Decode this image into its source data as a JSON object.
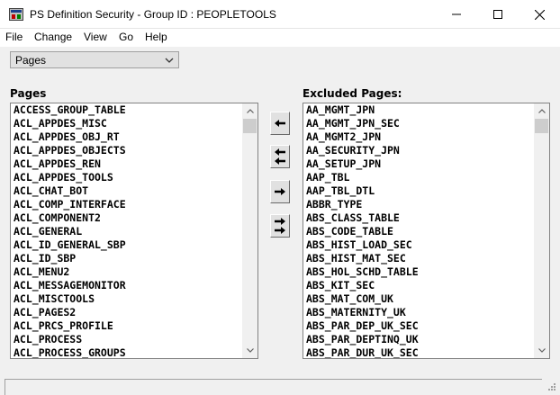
{
  "window": {
    "title": "PS Definition Security - Group ID : PEOPLETOOLS"
  },
  "menu": {
    "items": [
      "File",
      "Change",
      "View",
      "Go",
      "Help"
    ]
  },
  "object_type_select": {
    "value": "Pages"
  },
  "pages_list": {
    "label": "Pages",
    "items": [
      "ACCESS_GROUP_TABLE",
      "ACL_APPDES_MISC",
      "ACL_APPDES_OBJ_RT",
      "ACL_APPDES_OBJECTS",
      "ACL_APPDES_REN",
      "ACL_APPDES_TOOLS",
      "ACL_CHAT_BOT",
      "ACL_COMP_INTERFACE",
      "ACL_COMPONENT2",
      "ACL_GENERAL",
      "ACL_ID_GENERAL_SBP",
      "ACL_ID_SBP",
      "ACL_MENU2",
      "ACL_MESSAGEMONITOR",
      "ACL_MISCTOOLS",
      "ACL_PAGES2",
      "ACL_PRCS_PROFILE",
      "ACL_PROCESS",
      "ACL_PROCESS_GROUPS"
    ]
  },
  "excluded_list": {
    "label": "Excluded Pages:",
    "items": [
      "AA_MGMT_JPN",
      "AA_MGMT_JPN_SEC",
      "AA_MGMT2_JPN",
      "AA_SECURITY_JPN",
      "AA_SETUP_JPN",
      "AAP_TBL",
      "AAP_TBL_DTL",
      "ABBR_TYPE",
      "ABS_CLASS_TABLE",
      "ABS_CODE_TABLE",
      "ABS_HIST_LOAD_SEC",
      "ABS_HIST_MAT_SEC",
      "ABS_HOL_SCHD_TABLE",
      "ABS_KIT_SEC",
      "ABS_MAT_COM_UK",
      "ABS_MATERNITY_UK",
      "ABS_PAR_DEP_UK_SEC",
      "ABS_PAR_DEPTINQ_UK",
      "ABS_PAR_DUR_UK_SEC"
    ]
  },
  "icons": {
    "move_left": "arrow-left-icon",
    "move_all_left": "double-arrow-left-icon",
    "move_right": "arrow-right-icon",
    "move_all_right": "double-arrow-right-icon"
  }
}
